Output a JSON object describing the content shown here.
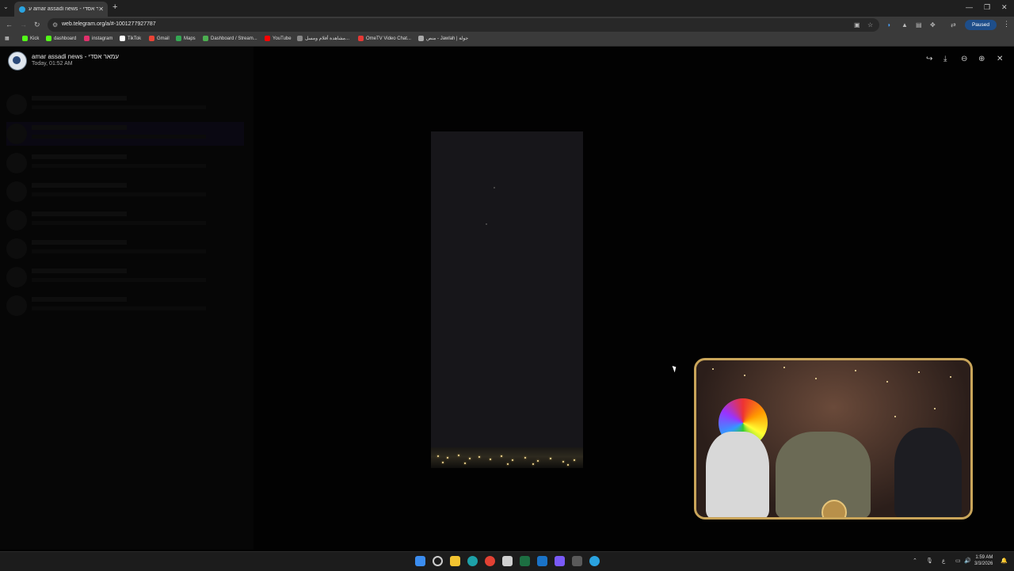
{
  "browser": {
    "tab_title": "ע amar assadi news - עמאר אסדי",
    "new_tab": "+",
    "url": "web.telegram.org/a/#-1001277927787",
    "profile_status": "Paused"
  },
  "bookmarks": [
    {
      "label": "Kick",
      "color": "#53fc18"
    },
    {
      "label": "dashboard",
      "color": "#53fc18"
    },
    {
      "label": "instagram",
      "color": "#e1306c"
    },
    {
      "label": "TikTok",
      "color": "#ffffff"
    },
    {
      "label": "Gmail",
      "color": "#ea4335"
    },
    {
      "label": "Maps",
      "color": "#34a853"
    },
    {
      "label": "Dashboard / Stream...",
      "color": "#4caf50"
    },
    {
      "label": "YouTube",
      "color": "#ff0000"
    },
    {
      "label": "مشاهدة أفلام ومسل...",
      "color": "#888888"
    },
    {
      "label": "OmeTV Video Chat...",
      "color": "#e53935"
    },
    {
      "label": "منص - Jawlah | جولة",
      "color": "#aaaaaa"
    }
  ],
  "viewer": {
    "channel_name": "amar assadi news - עמאר אסדי",
    "timestamp": "Today, 01:52 AM",
    "icons": [
      "forward-icon",
      "download-icon",
      "zoom-out-icon",
      "zoom-in-icon",
      "close-icon"
    ]
  },
  "taskbar": {
    "clock_time": "1:59 AM",
    "clock_date": "3/3/2026"
  }
}
